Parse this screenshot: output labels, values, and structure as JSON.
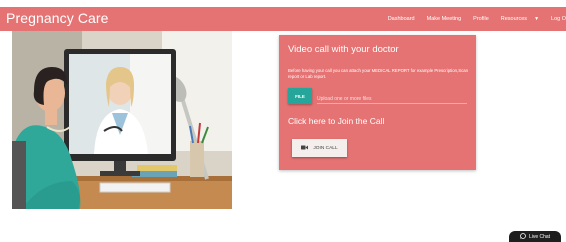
{
  "brand": {
    "title": "Pregnancy Care"
  },
  "nav": {
    "items": [
      {
        "label": "Dashboard"
      },
      {
        "label": "Make Meeting"
      },
      {
        "label": "Profile"
      },
      {
        "label": "Resources"
      },
      {
        "label": "Log O"
      }
    ]
  },
  "card": {
    "title": "Video call with your doctor",
    "description": "Before having your call you can attach your MEDICAL REPORT for example Prescription,Scan report or Lab report.",
    "file_button": "FILE",
    "file_placeholder": "Upload one or more files",
    "join_heading": "Click here to Join the Call",
    "join_button": "JOIN CALL"
  },
  "live_chat": {
    "label": "Live Chat"
  },
  "colors": {
    "primary": "#e57373",
    "file_button": "#26a69a",
    "join_button_bg": "#f4eeec",
    "live_chat_bg": "#1e1e1e"
  },
  "icons": {
    "join_button": "video-camera-icon",
    "live_chat": "whatsapp-icon",
    "resources_dropdown": "caret-down-icon"
  }
}
